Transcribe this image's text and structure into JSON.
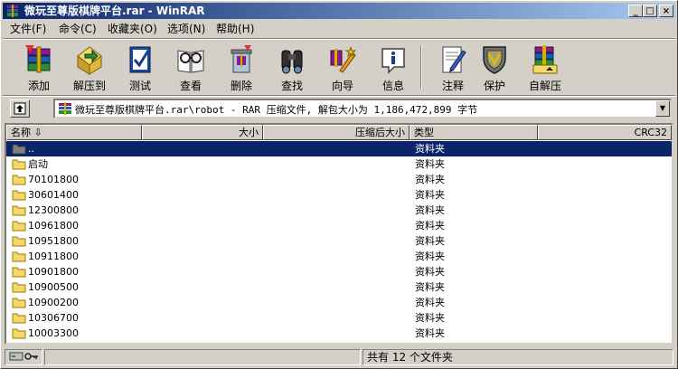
{
  "window": {
    "title": "微玩至尊版棋牌平台.rar - WinRAR"
  },
  "title_buttons": {
    "minimize": "_",
    "maximize": "□",
    "close": "×"
  },
  "menu": [
    {
      "label": "文件(F)"
    },
    {
      "label": "命令(C)"
    },
    {
      "label": "收藏夹(O)"
    },
    {
      "label": "选项(N)"
    },
    {
      "label": "帮助(H)"
    }
  ],
  "toolbar": [
    {
      "label": "添加",
      "icon": "add-archive-icon"
    },
    {
      "label": "解压到",
      "icon": "extract-to-icon"
    },
    {
      "label": "测试",
      "icon": "test-icon"
    },
    {
      "label": "查看",
      "icon": "view-icon"
    },
    {
      "label": "删除",
      "icon": "delete-icon"
    },
    {
      "label": "查找",
      "icon": "find-icon"
    },
    {
      "label": "向导",
      "icon": "wizard-icon"
    },
    {
      "label": "信息",
      "icon": "info-icon"
    },
    {
      "label": "注释",
      "icon": "comment-icon"
    },
    {
      "label": "保护",
      "icon": "protect-icon"
    },
    {
      "label": "自解压",
      "icon": "sfx-icon"
    }
  ],
  "address": {
    "path": "微玩至尊版棋牌平台.rar\\robot - RAR 压缩文件, 解包大小为 1,186,472,899 字节",
    "dropdown": "▼"
  },
  "columns": [
    {
      "label": "名称 ⇩"
    },
    {
      "label": "大小"
    },
    {
      "label": "压缩后大小"
    },
    {
      "label": "类型"
    },
    {
      "label": "CRC32"
    }
  ],
  "files": [
    {
      "name": "..",
      "type": "资料夹"
    },
    {
      "name": "启动",
      "type": "资料夹"
    },
    {
      "name": "70101800",
      "type": "资料夹"
    },
    {
      "name": "30601400",
      "type": "资料夹"
    },
    {
      "name": "12300800",
      "type": "资料夹"
    },
    {
      "name": "10961800",
      "type": "资料夹"
    },
    {
      "name": "10951800",
      "type": "资料夹"
    },
    {
      "name": "10911800",
      "type": "资料夹"
    },
    {
      "name": "10901800",
      "type": "资料夹"
    },
    {
      "name": "10900500",
      "type": "资料夹"
    },
    {
      "name": "10900200",
      "type": "资料夹"
    },
    {
      "name": "10306700",
      "type": "资料夹"
    },
    {
      "name": "10003300",
      "type": "资料夹"
    }
  ],
  "status": {
    "summary": "共有 12 个文件夹"
  },
  "colors": {
    "selection": "#0a246a",
    "folder": "#f5d86a",
    "titlebar": "#0a246a"
  }
}
